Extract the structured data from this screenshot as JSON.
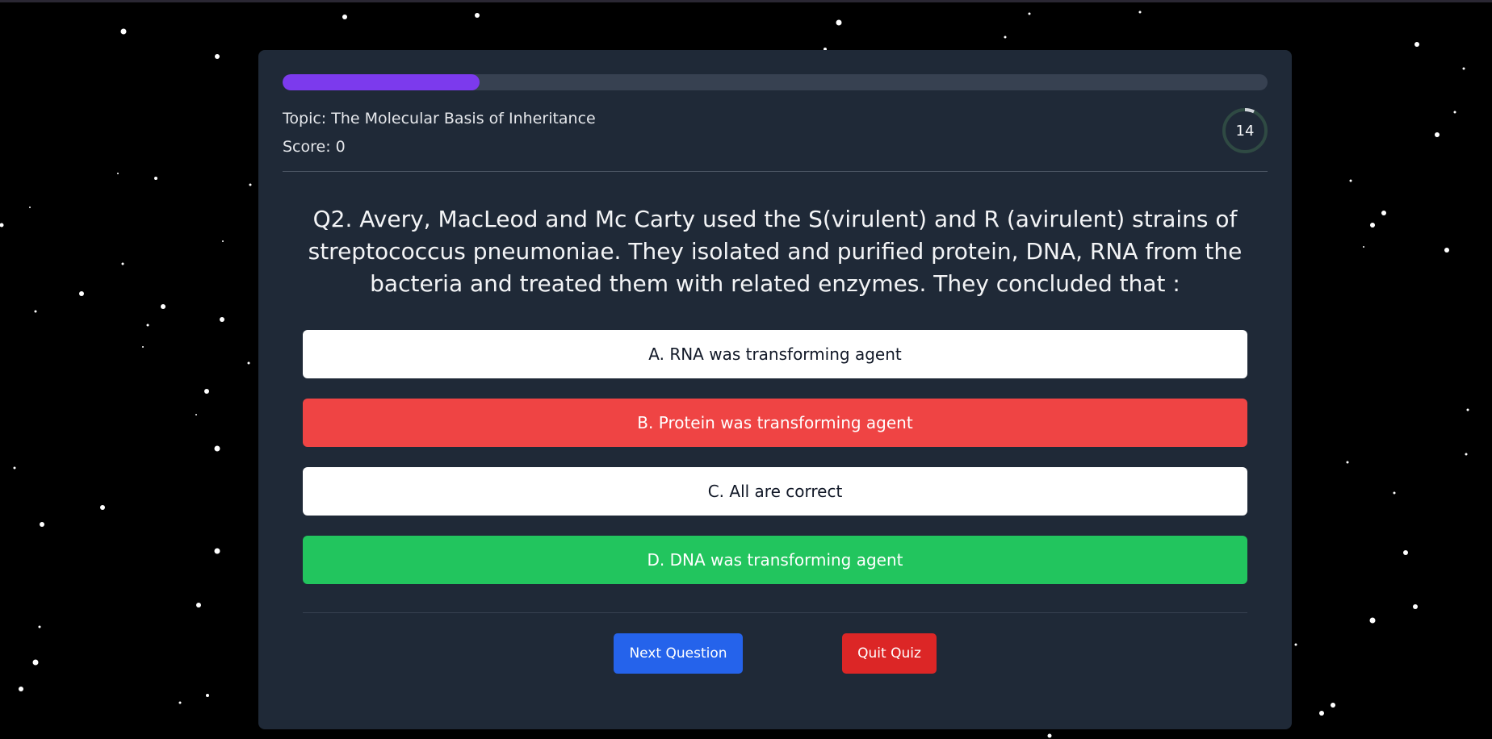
{
  "quiz": {
    "topic_text": "Topic: The Molecular Basis of Inheritance",
    "score_text": "Score: 0",
    "timer_value": "14",
    "timer_fraction_remaining": 0.93,
    "progress_fraction": 0.2,
    "question": "Q2. Avery, MacLeod and Mc Carty used the S(virulent) and R (avirulent) strains of streptococcus pneumoniae. They isolated and purified protein, DNA, RNA from the bacteria and treated them with related enzymes. They concluded that :",
    "options": [
      {
        "label": "A. RNA was transforming agent",
        "state": "neutral"
      },
      {
        "label": "B. Protein was transforming agent",
        "state": "wrong"
      },
      {
        "label": "C. All are correct",
        "state": "neutral"
      },
      {
        "label": "D. DNA was transforming agent",
        "state": "correct"
      }
    ],
    "next_label": "Next Question",
    "quit_label": "Quit Quiz"
  },
  "colors": {
    "background": "#000000",
    "card": "#1f2937",
    "progress_fill": "#7c3aed",
    "wrong": "#ef4444",
    "correct": "#22c55e",
    "next_button": "#2563eb",
    "quit_button": "#dc2626"
  }
}
